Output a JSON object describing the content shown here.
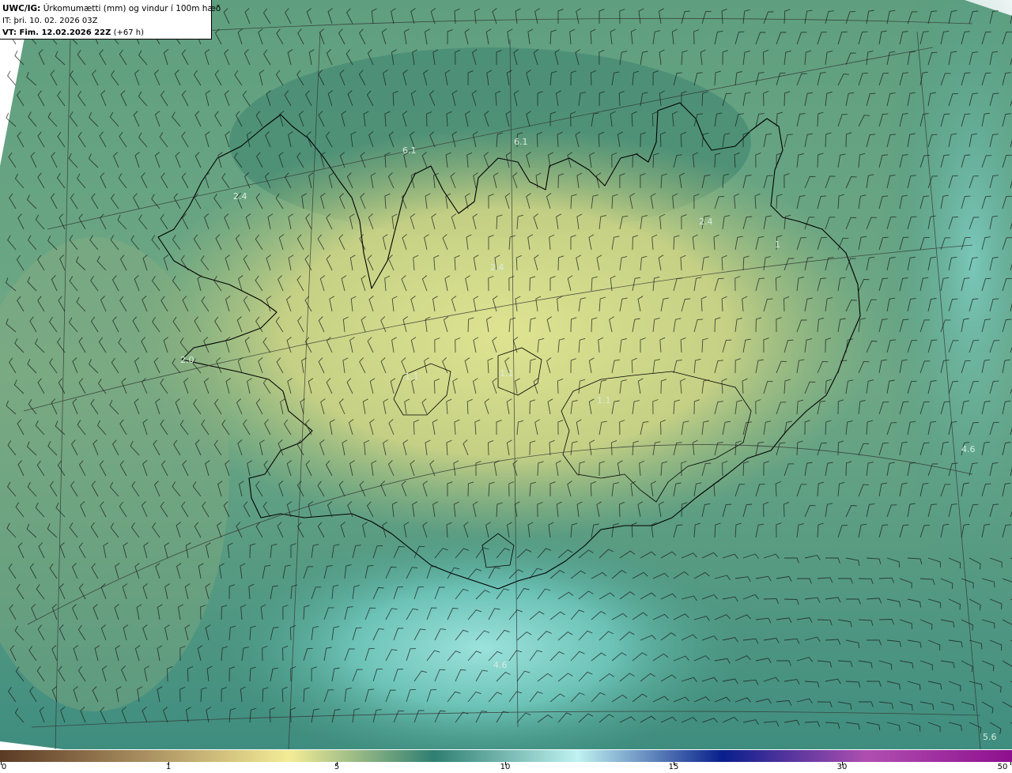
{
  "header": {
    "model": "UWC/IG:",
    "description": "Úrkomumætti (mm) og vindur í 100m hæð",
    "init_time": "IT: þri. 10. 02. 2026 03Z",
    "valid_label": "VT: Fim. 12.02.2026 22Z",
    "valid_offset": "(+67 h)"
  },
  "map_values": [
    {
      "text": "6.1"
    },
    {
      "text": "6.1"
    },
    {
      "text": "2.4"
    },
    {
      "text": "2.4"
    },
    {
      "text": "2.4"
    },
    {
      "text": "1"
    },
    {
      "text": "2.0"
    },
    {
      "text": "1.1"
    },
    {
      "text": "1.1"
    },
    {
      "text": "1.1"
    },
    {
      "text": "4.6"
    },
    {
      "text": "4.6"
    },
    {
      "text": "5.6"
    }
  ],
  "colorbar": {
    "ticks": [
      "0",
      "1",
      "5",
      "10",
      "15",
      "30",
      "50"
    ],
    "stops": [
      "#5b3a24",
      "#a98f60",
      "#f4ec96",
      "#2f7f72",
      "#bff2f0",
      "#081f8c",
      "#b04fb1",
      "#8e0f8e"
    ]
  },
  "colors": {
    "dry": "#e5e68c",
    "land_mid": "#b9c77c",
    "sea_mid": "#5c9d82",
    "sea_dark": "#2e7c6e",
    "sea_light": "#7ccfc6",
    "coast": "#000000",
    "wind_barb": "#1a1a1a",
    "grid": "#333333"
  }
}
